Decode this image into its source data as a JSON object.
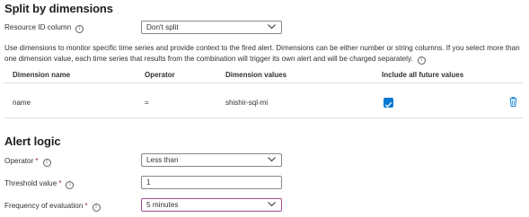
{
  "split_section": {
    "title": "Split by dimensions",
    "resource_id_label": "Resource ID column",
    "resource_id_value": "Don't split",
    "description": "Use dimensions to monitor specific time series and provide context to the fired alert. Dimensions can be either number or string columns. If you select more than one dimension value, each time series that results from the combination will trigger its own alert and will be charged separately.",
    "table": {
      "headers": [
        "Dimension name",
        "Operator",
        "Dimension values",
        "Include all future values"
      ],
      "rows": [
        {
          "name": "name",
          "operator": "=",
          "values": "shishir-sql-mi",
          "include_future": true
        }
      ]
    }
  },
  "alert_logic": {
    "title": "Alert logic",
    "operator_label": "Operator",
    "operator_value": "Less than",
    "threshold_label": "Threshold value",
    "threshold_value": "1",
    "frequency_label": "Frequency of evaluation",
    "frequency_value": "5 minutes",
    "required_marker": "*"
  },
  "colors": {
    "accent": "#0078d4",
    "required": "#a4262c",
    "focus_border": "#a34a8f",
    "delete_icon": "#0078d4"
  }
}
